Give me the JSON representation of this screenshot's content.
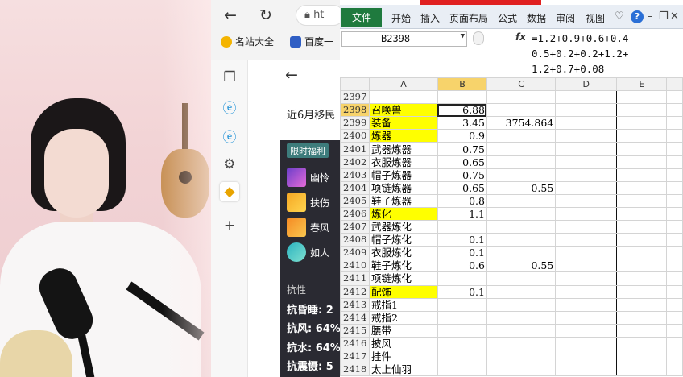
{
  "browser": {
    "address_text": "ht",
    "bookmarks": [
      {
        "label": "名站大全",
        "icon": "star-icon"
      },
      {
        "label": "百度一",
        "icon": "paw-icon"
      }
    ]
  },
  "sidebar_icons": [
    "tabs-icon",
    "edge-icon",
    "edge-icon",
    "settings-icon",
    "app-icon",
    "plus-icon"
  ],
  "page": {
    "title": "近6月移民",
    "tag": "限时福利",
    "items": [
      {
        "label": "幽怜"
      },
      {
        "label": "扶伤"
      },
      {
        "label": "春风"
      },
      {
        "label": "如人"
      }
    ],
    "stats_header": "抗性",
    "stats": [
      {
        "label": "抗昏睡: 2"
      },
      {
        "label": "抗风: 64%"
      },
      {
        "label": "抗水: 64%"
      },
      {
        "label": "抗震慑: 5"
      }
    ]
  },
  "excel": {
    "file_tab": "文件",
    "tabs": [
      "开始",
      "插入",
      "页面布局",
      "公式",
      "数据",
      "审阅",
      "视图"
    ],
    "name_box": "B2398",
    "fx": "fx",
    "formula_lines": [
      "=1.2+0.9+0.6+0.4",
      "0.5+0.2+0.2+1.2+",
      "1.2+0.7+0.08"
    ],
    "columns": [
      "A",
      "B",
      "C",
      "D",
      "E"
    ],
    "rows": [
      {
        "n": "2397",
        "a": "",
        "b": "",
        "c": ""
      },
      {
        "n": "2398",
        "a": "召唤兽",
        "b": "6.88",
        "c": "",
        "ya": true
      },
      {
        "n": "2399",
        "a": "装备",
        "b": "3.45",
        "c": "3754.864",
        "ya": true
      },
      {
        "n": "2400",
        "a": "炼器",
        "b": "0.9",
        "c": "",
        "ya": true
      },
      {
        "n": "2401",
        "a": "武器炼器",
        "b": "0.75",
        "c": ""
      },
      {
        "n": "2402",
        "a": "衣服炼器",
        "b": "0.65",
        "c": ""
      },
      {
        "n": "2403",
        "a": "帽子炼器",
        "b": "0.75",
        "c": ""
      },
      {
        "n": "2404",
        "a": "项链炼器",
        "b": "0.65",
        "c": "0.55"
      },
      {
        "n": "2405",
        "a": "鞋子炼器",
        "b": "0.8",
        "c": ""
      },
      {
        "n": "2406",
        "a": "炼化",
        "b": "1.1",
        "c": "",
        "ya": true
      },
      {
        "n": "2407",
        "a": "武器炼化",
        "b": "",
        "c": ""
      },
      {
        "n": "2408",
        "a": "帽子炼化",
        "b": "0.1",
        "c": ""
      },
      {
        "n": "2409",
        "a": "衣服炼化",
        "b": "0.1",
        "c": ""
      },
      {
        "n": "2410",
        "a": "鞋子炼化",
        "b": "0.6",
        "c": "0.55"
      },
      {
        "n": "2411",
        "a": "项链炼化",
        "b": "",
        "c": ""
      },
      {
        "n": "2412",
        "a": "配饰",
        "b": "0.1",
        "c": "",
        "ya": true
      },
      {
        "n": "2413",
        "a": "戒指1",
        "b": "",
        "c": ""
      },
      {
        "n": "2414",
        "a": "戒指2",
        "b": "",
        "c": ""
      },
      {
        "n": "2415",
        "a": "腰带",
        "b": "",
        "c": ""
      },
      {
        "n": "2416",
        "a": "披风",
        "b": "",
        "c": ""
      },
      {
        "n": "2417",
        "a": "挂件",
        "b": "",
        "c": ""
      },
      {
        "n": "2418",
        "a": "太上仙羽",
        "b": "",
        "c": ""
      }
    ]
  },
  "colors": {
    "excel_green": "#1f7a3e",
    "highlight_yellow": "#ffff00",
    "selected_header": "#f7d36b",
    "cam_bg": "#f2d3d5"
  }
}
